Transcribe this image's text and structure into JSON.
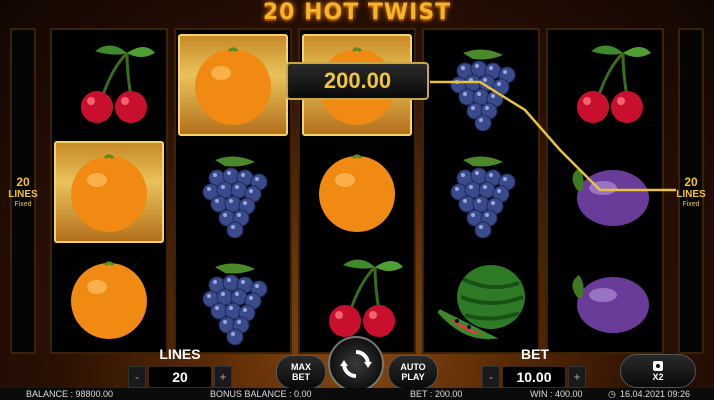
{
  "game": {
    "title": "20 HOT TWIST"
  },
  "side_panels": {
    "lines_number": "20",
    "lines_label": "LINES",
    "fixed_label": "Fixed"
  },
  "reels": [
    [
      "cherry",
      "orange",
      "orange"
    ],
    [
      "orange",
      "grapes",
      "grapes"
    ],
    [
      "orange",
      "orange",
      "cherry"
    ],
    [
      "grapes",
      "grapes",
      "watermelon"
    ],
    [
      "cherry",
      "plum",
      "plum"
    ]
  ],
  "winning_cells": [
    [
      0,
      1
    ],
    [
      1,
      0
    ],
    [
      2,
      0
    ]
  ],
  "win_display": {
    "amount": "200.00",
    "line_color": "#e8c23a"
  },
  "controls": {
    "lines_label": "LINES",
    "lines_value": "20",
    "bet_label": "BET",
    "bet_value": "10.00",
    "minus": "-",
    "plus": "+",
    "max_bet_line1": "MAX",
    "max_bet_line2": "BET",
    "auto_play_line1": "AUTO",
    "auto_play_line2": "PLAY",
    "x2_label": "X2"
  },
  "status": {
    "balance": "BALANCE : 98800.00",
    "bonus_balance": "BONUS BALANCE : 0.00",
    "bet": "BET : 200.00",
    "win": "WIN : 400.00",
    "datetime": "16.04.2021 09:26"
  },
  "colors": {
    "accent_gold": "#f5b428",
    "win_frame": "#f7d46a"
  },
  "icons": {
    "spin": "refresh-arrows-icon",
    "x2": "gamble-card-icon",
    "clock": "clock-icon"
  }
}
